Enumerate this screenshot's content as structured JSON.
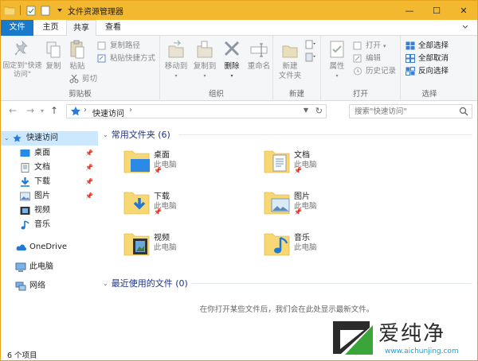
{
  "window": {
    "title": "文件资源管理器",
    "accent": "#f2b830",
    "controls": {
      "minimize": "—",
      "maximize": "☐",
      "close": "✕"
    }
  },
  "ribbon_tabs": [
    {
      "label": "文件"
    },
    {
      "label": "主页"
    },
    {
      "label": "共享"
    },
    {
      "label": "查看"
    }
  ],
  "ribbon": {
    "clipboard": {
      "label": "剪贴板",
      "pin_quick": "固定到\"快速访问\"",
      "copy": "复制",
      "paste": "粘贴",
      "copy_path": "复制路径",
      "paste_shortcut": "粘贴快捷方式",
      "cut": "剪切"
    },
    "organize": {
      "label": "组织",
      "move_to": "移动到",
      "copy_to": "复制到",
      "delete": "删除",
      "rename": "重命名"
    },
    "new": {
      "label": "新建",
      "new_folder": "新建\n文件夹"
    },
    "open": {
      "label": "打开",
      "properties": "属性",
      "open": "打开",
      "edit": "编辑",
      "history": "历史记录"
    },
    "select": {
      "label": "选择",
      "select_all": "全部选择",
      "select_none": "全部取消",
      "invert": "反向选择"
    }
  },
  "address": {
    "crumb": "快速访问",
    "search_placeholder": "搜索\"快速访问\""
  },
  "nav_pane": {
    "quick_access": "快速访问",
    "items": [
      {
        "label": "桌面",
        "pinned": "📌"
      },
      {
        "label": "文档",
        "pinned": "📌"
      },
      {
        "label": "下载",
        "pinned": "📌"
      },
      {
        "label": "图片",
        "pinned": "📌"
      },
      {
        "label": "视频",
        "pinned": ""
      },
      {
        "label": "音乐",
        "pinned": ""
      }
    ],
    "onedrive": "OneDrive",
    "this_pc": "此电脑",
    "network": "网络"
  },
  "content": {
    "frequent_header": "常用文件夹 (6)",
    "folders": [
      {
        "name": "桌面",
        "location": "此电脑",
        "icon": "desktop-folder-icon"
      },
      {
        "name": "文档",
        "location": "此电脑",
        "icon": "documents-folder-icon"
      },
      {
        "name": "下载",
        "location": "此电脑",
        "icon": "downloads-folder-icon"
      },
      {
        "name": "图片",
        "location": "此电脑",
        "icon": "pictures-folder-icon"
      },
      {
        "name": "视频",
        "location": "此电脑",
        "icon": "videos-folder-icon"
      },
      {
        "name": "音乐",
        "location": "此电脑",
        "icon": "music-folder-icon"
      }
    ],
    "recent_header": "最近使用的文件 (0)",
    "recent_empty": "在你打开某些文件后，我们会在此处显示最新文件。"
  },
  "status": {
    "item_count": "6 个项目"
  },
  "watermark": {
    "text": "爱纯净",
    "url": "www.aichunjing.com"
  }
}
